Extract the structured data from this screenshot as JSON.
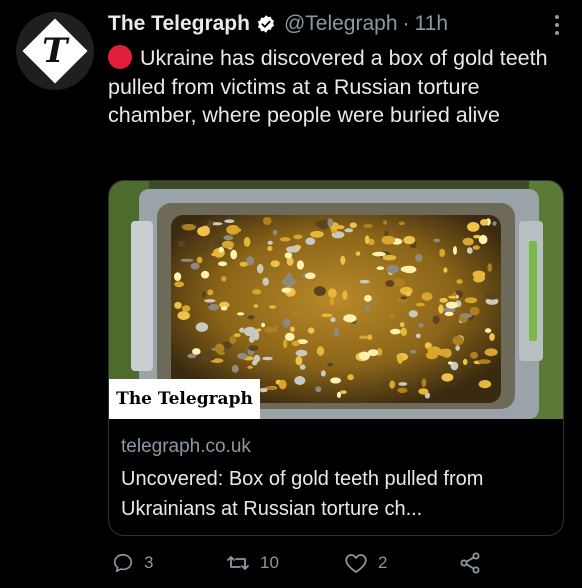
{
  "author": {
    "name": "The Telegraph",
    "handle": "@Telegraph",
    "separator": "·",
    "time": "11h",
    "avatar_glyph": "T",
    "verified_icon": "verified-badge-icon"
  },
  "tweet": {
    "line_prefix_icon": "red-circle-icon",
    "text": "Ukraine has discovered a box of gold teeth pulled from victims at a Russian torture chamber, where people were buried alive"
  },
  "card": {
    "image_watermark": "The Telegraph",
    "domain": "telegraph.co.uk",
    "title": "Uncovered: Box of gold teeth pulled from Ukrainians at Russian torture ch..."
  },
  "actions": {
    "reply_count": "3",
    "retweet_count": "10",
    "like_count": "2"
  },
  "colors": {
    "background": "#000000",
    "text": "#e7e9ea",
    "secondary": "#8b98a5",
    "verified": "#ffffff",
    "alert_red": "#e0203a"
  }
}
